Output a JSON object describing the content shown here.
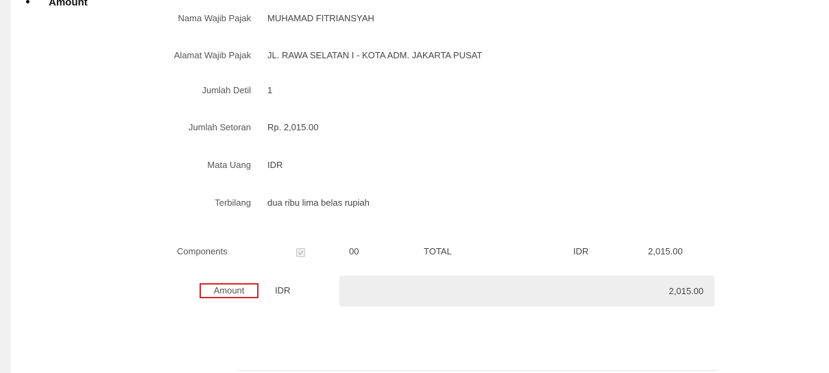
{
  "doc_heading": "Amount",
  "fields": [
    {
      "label": "Nama Wajib Pajak",
      "value": "MUHAMAD FITRIANSYAH"
    },
    {
      "label": "Alamat Wajib Pajak",
      "value": "JL. RAWA SELATAN I - KOTA ADM. JAKARTA PUSAT"
    },
    {
      "label": "Jumlah Detil",
      "value": "1"
    },
    {
      "label": "Jumlah Setoran",
      "value": "Rp. 2,015.00"
    },
    {
      "label": "Mata Uang",
      "value": "IDR"
    },
    {
      "label": "Terbilang",
      "value": "dua ribu lima belas rupiah"
    }
  ],
  "components": {
    "label": "Components",
    "checked": true,
    "code": "00",
    "name": "TOTAL",
    "currency": "IDR",
    "amount": "2,015.00"
  },
  "amount": {
    "label": "Amount",
    "currency": "IDR",
    "value": "2,015.00"
  },
  "colors": {
    "highlight_border": "#d0262a",
    "input_background": "#eeeeee"
  }
}
